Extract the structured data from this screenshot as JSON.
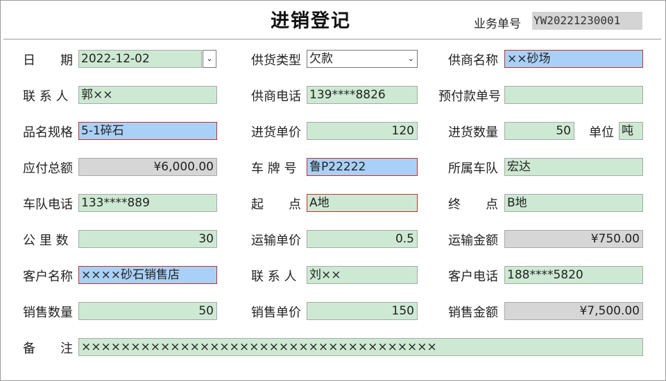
{
  "header": {
    "title": "进销登记",
    "docno_label": "业务单号",
    "docno_value": "YW20221230001"
  },
  "form": {
    "date": {
      "label": "日　　期",
      "value": "2022-12-02",
      "dropdown": "⌄"
    },
    "supply_type": {
      "label": "供货类型",
      "value": "欠款",
      "dropdown": "⌄"
    },
    "supplier_name": {
      "label": "供商名称",
      "value": "××砂场"
    },
    "contact": {
      "label": "联 系 人",
      "value": "郭××"
    },
    "supplier_phone": {
      "label": "供商电话",
      "value": "139****8826"
    },
    "prepay_no": {
      "label": "预付款单号",
      "value": ""
    },
    "product": {
      "label": "品名规格",
      "value": "5-1碎石"
    },
    "purchase_price": {
      "label": "进货单价",
      "value": "120"
    },
    "purchase_qty": {
      "label": "进货数量",
      "value": "50"
    },
    "unit": {
      "label": "单位",
      "value": "吨"
    },
    "payable_total": {
      "label": "应付总额",
      "value": "¥6,000.00"
    },
    "plate": {
      "label": "车 牌 号",
      "value": "鲁P22222"
    },
    "fleet": {
      "label": "所属车队",
      "value": "宏达"
    },
    "fleet_phone": {
      "label": "车队电话",
      "value": "133****889"
    },
    "origin": {
      "label": "起　　点",
      "value": "A地"
    },
    "destination": {
      "label": "终　　点",
      "value": "B地"
    },
    "km": {
      "label": "公 里 数",
      "value": "30"
    },
    "freight_price": {
      "label": "运输单价",
      "value": "0.5"
    },
    "freight_amount": {
      "label": "运输金额",
      "value": "¥750.00"
    },
    "customer_name": {
      "label": "客户名称",
      "value": "××××砂石销售店"
    },
    "customer_contact": {
      "label": "联 系 人",
      "value": "刘××"
    },
    "customer_phone": {
      "label": "客户电话",
      "value": "188****5820"
    },
    "sales_qty": {
      "label": "销售数量",
      "value": "50"
    },
    "sales_price": {
      "label": "销售单价",
      "value": "150"
    },
    "sales_amount": {
      "label": "销售金额",
      "value": "¥7,500.00"
    },
    "remark": {
      "label": "备　　注",
      "value": "××××××××××××××××××××××××××××××××××××"
    }
  }
}
